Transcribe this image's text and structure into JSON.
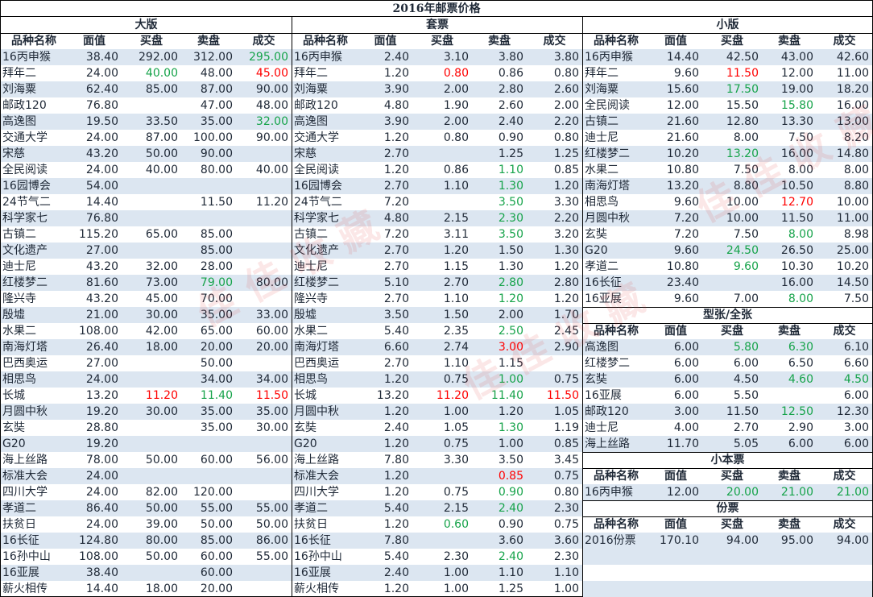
{
  "title": "2016年邮票价格",
  "headers": {
    "name": "品种名称",
    "face": "面值",
    "buy": "买盘",
    "sell": "卖盘",
    "deal": "成交"
  },
  "colors": {
    "alt_row": "#dce6f1",
    "red": "#ff0000",
    "green": "#16a34a"
  },
  "panels": {
    "large": {
      "title": "大版",
      "rows": [
        {
          "name": "16丙申猴",
          "face": "38.40",
          "buy": "292.00",
          "sell": "312.00",
          "deal": "295.00",
          "deal_color": "green"
        },
        {
          "name": "拜年二",
          "face": "24.00",
          "buy": "40.00",
          "sell": "48.00",
          "deal": "45.00",
          "buy_color": "green",
          "deal_color": "red"
        },
        {
          "name": "刘海粟",
          "face": "62.40",
          "buy": "85.00",
          "sell": "87.00",
          "deal": "90.00"
        },
        {
          "name": "邮政120",
          "face": "76.80",
          "buy": "",
          "sell": "47.00",
          "deal": "48.00"
        },
        {
          "name": "高逸图",
          "face": "19.50",
          "buy": "33.50",
          "sell": "35.00",
          "deal": "32.00",
          "deal_color": "green"
        },
        {
          "name": "交通大学",
          "face": "24.00",
          "buy": "87.00",
          "sell": "100.00",
          "deal": "90.00"
        },
        {
          "name": "宋慈",
          "face": "43.20",
          "buy": "50.00",
          "sell": "90.00",
          "deal": ""
        },
        {
          "name": "全民阅读",
          "face": "24.00",
          "buy": "40.00",
          "sell": "80.00",
          "deal": "40.00"
        },
        {
          "name": "16园博会",
          "face": "54.00",
          "buy": "",
          "sell": "",
          "deal": ""
        },
        {
          "name": "24节气二",
          "face": "14.40",
          "buy": "",
          "sell": "11.50",
          "deal": "11.20"
        },
        {
          "name": "科学家七",
          "face": "76.80",
          "buy": "",
          "sell": "",
          "deal": ""
        },
        {
          "name": "古镇二",
          "face": "115.20",
          "buy": "65.00",
          "sell": "85.00",
          "deal": ""
        },
        {
          "name": "文化遗产",
          "face": "27.00",
          "buy": "",
          "sell": "85.00",
          "deal": ""
        },
        {
          "name": "迪士尼",
          "face": "43.20",
          "buy": "32.00",
          "sell": "28.00",
          "deal": ""
        },
        {
          "name": "红楼梦二",
          "face": "81.60",
          "buy": "73.00",
          "sell": "79.00",
          "deal": "80.00",
          "sell_color": "green"
        },
        {
          "name": "隆兴寺",
          "face": "43.20",
          "buy": "45.00",
          "sell": "70.00",
          "deal": ""
        },
        {
          "name": "殷墟",
          "face": "21.00",
          "buy": "30.00",
          "sell": "35.00",
          "deal": "33.00"
        },
        {
          "name": "水果二",
          "face": "108.00",
          "buy": "42.00",
          "sell": "65.00",
          "deal": "60.00"
        },
        {
          "name": "南海灯塔",
          "face": "26.40",
          "buy": "18.00",
          "sell": "20.00",
          "deal": "20.00"
        },
        {
          "name": "巴西奥运",
          "face": "27.00",
          "buy": "",
          "sell": "50.00",
          "deal": ""
        },
        {
          "name": "相思鸟",
          "face": "24.00",
          "buy": "",
          "sell": "34.00",
          "deal": "34.00"
        },
        {
          "name": "长城",
          "face": "13.20",
          "buy": "11.20",
          "sell": "11.40",
          "deal": "11.50",
          "buy_color": "red",
          "sell_color": "green",
          "deal_color": "red"
        },
        {
          "name": "月圆中秋",
          "face": "19.20",
          "buy": "30.00",
          "sell": "35.00",
          "deal": "35.00"
        },
        {
          "name": "玄奘",
          "face": "28.80",
          "buy": "",
          "sell": "35.00",
          "deal": "30.00"
        },
        {
          "name": "G20",
          "face": "19.20",
          "buy": "",
          "sell": "",
          "deal": ""
        },
        {
          "name": "海上丝路",
          "face": "78.00",
          "buy": "50.00",
          "sell": "60.00",
          "deal": "56.00"
        },
        {
          "name": "标准大会",
          "face": "24.00",
          "buy": "",
          "sell": "",
          "deal": ""
        },
        {
          "name": "四川大学",
          "face": "24.00",
          "buy": "82.00",
          "sell": "120.00",
          "deal": ""
        },
        {
          "name": "孝道二",
          "face": "86.40",
          "buy": "50.00",
          "sell": "55.00",
          "deal": "55.00"
        },
        {
          "name": "扶贫日",
          "face": "24.00",
          "buy": "39.00",
          "sell": "50.00",
          "deal": "50.00"
        },
        {
          "name": "16长征",
          "face": "124.80",
          "buy": "80.00",
          "sell": "85.00",
          "deal": "86.00"
        },
        {
          "name": "16孙中山",
          "face": "108.00",
          "buy": "50.00",
          "sell": "60.00",
          "deal": "55.00"
        },
        {
          "name": "16亚展",
          "face": "38.40",
          "buy": "",
          "sell": "60.00",
          "deal": ""
        },
        {
          "name": "薪火相传",
          "face": "14.40",
          "buy": "18.00",
          "sell": "20.00",
          "deal": ""
        }
      ]
    },
    "set": {
      "title": "套票",
      "rows": [
        {
          "name": "16丙申猴",
          "face": "2.40",
          "buy": "3.10",
          "sell": "3.80",
          "deal": "3.80"
        },
        {
          "name": "拜年二",
          "face": "1.20",
          "buy": "0.80",
          "sell": "0.86",
          "deal": "0.80",
          "buy_color": "red"
        },
        {
          "name": "刘海粟",
          "face": "3.90",
          "buy": "2.00",
          "sell": "2.80",
          "deal": "2.60"
        },
        {
          "name": "邮政120",
          "face": "4.80",
          "buy": "1.90",
          "sell": "2.60",
          "deal": "2.00"
        },
        {
          "name": "高逸图",
          "face": "3.90",
          "buy": "2.00",
          "sell": "2.40",
          "deal": "2.20"
        },
        {
          "name": "交通大学",
          "face": "1.20",
          "buy": "0.80",
          "sell": "0.90",
          "deal": "0.80"
        },
        {
          "name": "宋慈",
          "face": "2.70",
          "buy": "",
          "sell": "1.25",
          "deal": "1.25"
        },
        {
          "name": "全民阅读",
          "face": "1.20",
          "buy": "0.86",
          "sell": "1.10",
          "deal": "0.85",
          "sell_color": "green"
        },
        {
          "name": "16园博会",
          "face": "2.70",
          "buy": "1.10",
          "sell": "1.30",
          "deal": "1.20",
          "sell_color": "green"
        },
        {
          "name": "24节气二",
          "face": "7.20",
          "buy": "",
          "sell": "3.50",
          "deal": "3.30",
          "sell_color": "green"
        },
        {
          "name": "科学家七",
          "face": "4.80",
          "buy": "2.15",
          "sell": "2.30",
          "deal": "2.20",
          "sell_color": "green"
        },
        {
          "name": "古镇二",
          "face": "7.20",
          "buy": "3.11",
          "sell": "3.50",
          "deal": "3.20",
          "sell_color": "green"
        },
        {
          "name": "文化遗产",
          "face": "2.70",
          "buy": "1.20",
          "sell": "1.50",
          "deal": "1.30"
        },
        {
          "name": "迪士尼",
          "face": "2.70",
          "buy": "1.15",
          "sell": "1.30",
          "deal": "1.20"
        },
        {
          "name": "红楼梦二",
          "face": "5.10",
          "buy": "2.70",
          "sell": "2.80",
          "deal": "2.80",
          "sell_color": "green"
        },
        {
          "name": "隆兴寺",
          "face": "2.70",
          "buy": "1.10",
          "sell": "1.20",
          "deal": "1.20",
          "sell_color": "green"
        },
        {
          "name": "殷墟",
          "face": "3.50",
          "buy": "1.50",
          "sell": "2.00",
          "deal": "1.70"
        },
        {
          "name": "水果二",
          "face": "5.40",
          "buy": "2.35",
          "sell": "2.50",
          "deal": "2.45",
          "sell_color": "green"
        },
        {
          "name": "南海灯塔",
          "face": "6.60",
          "buy": "2.74",
          "sell": "3.00",
          "deal": "2.90",
          "sell_color": "red"
        },
        {
          "name": "巴西奥运",
          "face": "2.70",
          "buy": "1.10",
          "sell": "1.15",
          "deal": ""
        },
        {
          "name": "相思鸟",
          "face": "1.20",
          "buy": "0.75",
          "sell": "1.00",
          "deal": "0.75",
          "sell_color": "green"
        },
        {
          "name": "长城",
          "face": "13.20",
          "buy": "11.20",
          "sell": "11.40",
          "deal": "11.50",
          "buy_color": "red",
          "sell_color": "green",
          "deal_color": "red"
        },
        {
          "name": "月圆中秋",
          "face": "1.20",
          "buy": "1.00",
          "sell": "1.20",
          "deal": "1.05"
        },
        {
          "name": "玄奘",
          "face": "2.40",
          "buy": "1.05",
          "sell": "1.30",
          "deal": "1.19",
          "sell_color": "green"
        },
        {
          "name": "G20",
          "face": "1.20",
          "buy": "0.75",
          "sell": "1.00",
          "deal": "0.85"
        },
        {
          "name": "海上丝路",
          "face": "7.80",
          "buy": "3.30",
          "sell": "3.50",
          "deal": "3.45"
        },
        {
          "name": "标准大会",
          "face": "1.20",
          "buy": "",
          "sell": "0.85",
          "deal": "0.75",
          "sell_color": "red"
        },
        {
          "name": "四川大学",
          "face": "1.20",
          "buy": "0.75",
          "sell": "0.90",
          "deal": "0.80",
          "sell_color": "green"
        },
        {
          "name": "孝道二",
          "face": "5.40",
          "buy": "2.15",
          "sell": "2.40",
          "deal": "2.30",
          "sell_color": "green"
        },
        {
          "name": "扶贫日",
          "face": "1.20",
          "buy": "0.60",
          "sell": "0.90",
          "deal": "0.75",
          "buy_color": "green"
        },
        {
          "name": "16长征",
          "face": "7.80",
          "buy": "",
          "sell": "3.60",
          "deal": "3.60"
        },
        {
          "name": "16孙中山",
          "face": "5.40",
          "buy": "2.30",
          "sell": "2.40",
          "deal": "2.30",
          "sell_color": "green"
        },
        {
          "name": "16亚展",
          "face": "2.40",
          "buy": "1.00",
          "sell": "1.10",
          "deal": "1.10"
        },
        {
          "name": "薪火相传",
          "face": "1.20",
          "buy": "1.00",
          "sell": "1.25",
          "deal": "1.00"
        }
      ]
    },
    "small": {
      "title": "小版",
      "rows": [
        {
          "name": "16丙申猴",
          "face": "14.40",
          "buy": "42.50",
          "sell": "43.00",
          "deal": "42.60"
        },
        {
          "name": "拜年二",
          "face": "9.60",
          "buy": "11.50",
          "sell": "12.00",
          "deal": "11.00",
          "buy_color": "red"
        },
        {
          "name": "刘海粟",
          "face": "15.60",
          "buy": "17.50",
          "sell": "19.00",
          "deal": "18.20",
          "buy_color": "green"
        },
        {
          "name": "全民阅读",
          "face": "12.00",
          "buy": "15.50",
          "sell": "15.80",
          "deal": "16.00",
          "sell_color": "green"
        },
        {
          "name": "古镇二",
          "face": "21.60",
          "buy": "12.80",
          "sell": "13.30",
          "deal": "13.00"
        },
        {
          "name": "迪士尼",
          "face": "21.60",
          "buy": "8.00",
          "sell": "7.50",
          "deal": "8.20"
        },
        {
          "name": "红楼梦二",
          "face": "10.20",
          "buy": "13.20",
          "sell": "16.00",
          "deal": "14.80",
          "buy_color": "green"
        },
        {
          "name": "水果二",
          "face": "10.80",
          "buy": "7.50",
          "sell": "8.00",
          "deal": "8.00"
        },
        {
          "name": "南海灯塔",
          "face": "13.20",
          "buy": "8.80",
          "sell": "10.50",
          "deal": "8.80"
        },
        {
          "name": "相思鸟",
          "face": "9.60",
          "buy": "10.00",
          "sell": "12.70",
          "deal": "10.00",
          "sell_color": "red"
        },
        {
          "name": "月圆中秋",
          "face": "7.20",
          "buy": "10.00",
          "sell": "11.50",
          "deal": "11.00"
        },
        {
          "name": "玄奘",
          "face": "7.20",
          "buy": "7.50",
          "sell": "8.00",
          "deal": "8.98",
          "sell_color": "green"
        },
        {
          "name": "G20",
          "face": "9.60",
          "buy": "24.50",
          "sell": "26.50",
          "deal": "25.00",
          "buy_color": "green"
        },
        {
          "name": "孝道二",
          "face": "10.80",
          "buy": "9.60",
          "sell": "10.30",
          "deal": "10.20",
          "buy_color": "green"
        },
        {
          "name": "16长征",
          "face": "23.40",
          "buy": "",
          "sell": "16.00",
          "deal": "14.50"
        },
        {
          "name": "16亚展",
          "face": "9.60",
          "buy": "7.00",
          "sell": "8.00",
          "deal": "7.50",
          "sell_color": "green"
        }
      ]
    },
    "sheetlet": {
      "title": "型张/全张",
      "rows": [
        {
          "name": "高逸图",
          "face": "6.00",
          "buy": "5.80",
          "sell": "6.30",
          "deal": "6.10",
          "buy_color": "green",
          "sell_color": "green"
        },
        {
          "name": "红楼梦二",
          "face": "6.00",
          "buy": "6.00",
          "sell": "6.50",
          "deal": "6.60"
        },
        {
          "name": "玄奘",
          "face": "6.00",
          "buy": "4.50",
          "sell": "4.60",
          "deal": "4.50",
          "sell_color": "green",
          "deal_color": "green"
        },
        {
          "name": "16亚展",
          "face": "6.00",
          "buy": "5.50",
          "sell": "",
          "deal": "6.00"
        },
        {
          "name": "邮政120",
          "face": "3.00",
          "buy": "11.50",
          "sell": "12.50",
          "deal": "12.30",
          "sell_color": "green"
        },
        {
          "name": "迪士尼",
          "face": "4.00",
          "buy": "2.70",
          "sell": "2.90",
          "deal": "3.00"
        },
        {
          "name": "海上丝路",
          "face": "11.70",
          "buy": "5.05",
          "sell": "6.00",
          "deal": "6.00"
        }
      ]
    },
    "booklet": {
      "title": "小本票",
      "rows": [
        {
          "name": "16丙申猴",
          "face": "12.00",
          "buy": "20.00",
          "sell": "21.00",
          "deal": "21.00",
          "buy_color": "green",
          "sell_color": "green",
          "deal_color": "green"
        }
      ]
    },
    "yearset": {
      "title": "份票",
      "rows": [
        {
          "name": "2016份票",
          "face": "170.10",
          "buy": "94.00",
          "sell": "95.00",
          "deal": "94.00"
        }
      ]
    }
  },
  "watermark_text": "佳佳收藏"
}
